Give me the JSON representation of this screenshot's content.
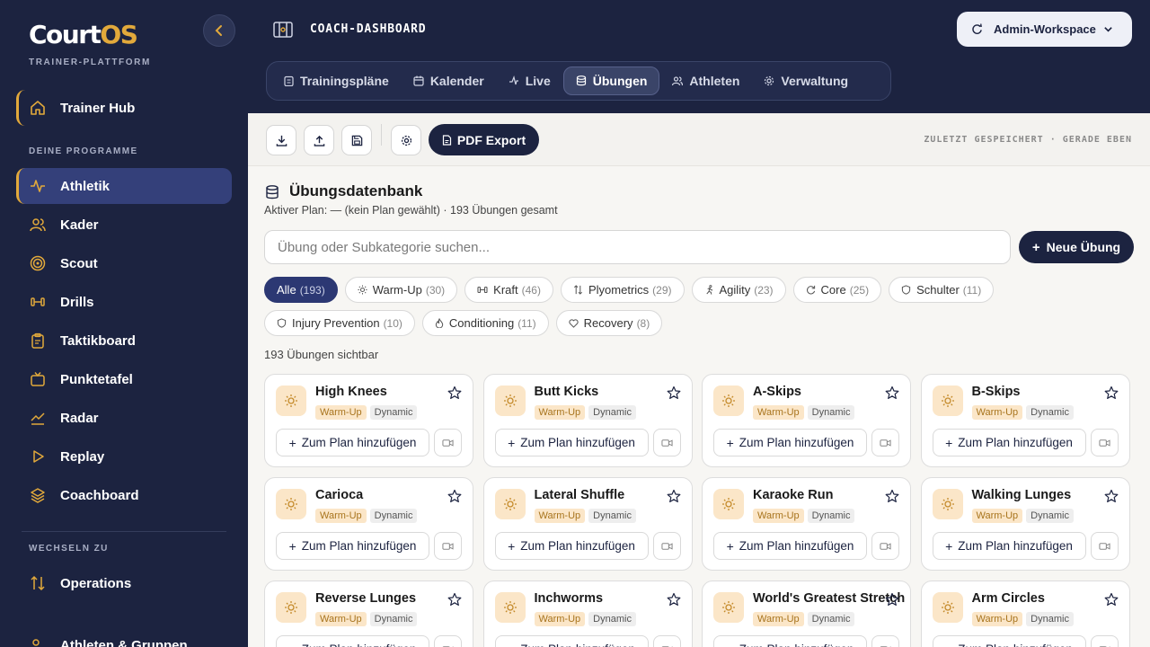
{
  "brand": {
    "name_part1": "Court",
    "name_part2": "OS",
    "subtitle": "TRAINER-PLATTFORM",
    "accent_color": "#e2a93b",
    "navy_color": "#1c2340"
  },
  "sidebar": {
    "hub_label": "Trainer Hub",
    "programs_heading": "DEINE PROGRAMME",
    "items": [
      {
        "label": "Athletik",
        "icon": "activity-icon",
        "active": true
      },
      {
        "label": "Kader",
        "icon": "users-icon"
      },
      {
        "label": "Scout",
        "icon": "target-icon"
      },
      {
        "label": "Drills",
        "icon": "dumbbell-icon"
      },
      {
        "label": "Taktikboard",
        "icon": "clipboard-icon"
      },
      {
        "label": "Punktetafel",
        "icon": "tv-icon"
      },
      {
        "label": "Radar",
        "icon": "chart-line-icon"
      },
      {
        "label": "Replay",
        "icon": "play-icon"
      },
      {
        "label": "Coachboard",
        "icon": "layers-icon"
      }
    ],
    "switch_heading": "WECHSELN ZU",
    "switch_item": "Operations",
    "bottom_item": "Athleten & Gruppen"
  },
  "header": {
    "title": "COACH-DASHBOARD",
    "workspace": "Admin-Workspace",
    "tabs": [
      {
        "label": "Trainingspläne",
        "icon": "clipboard-icon"
      },
      {
        "label": "Kalender",
        "icon": "calendar-icon"
      },
      {
        "label": "Live",
        "icon": "pulse-icon"
      },
      {
        "label": "Übungen",
        "icon": "database-icon",
        "active": true
      },
      {
        "label": "Athleten",
        "icon": "users-icon"
      },
      {
        "label": "Verwaltung",
        "icon": "gear-icon"
      }
    ]
  },
  "toolbar": {
    "pdf_label": "PDF Export",
    "saved_status": "ZULETZT GESPEICHERT · GERADE EBEN"
  },
  "database": {
    "title": "Übungsdatenbank",
    "subtitle": "Aktiver Plan: — (kein Plan gewählt) · 193 Übungen gesamt",
    "search_placeholder": "Übung oder Subkategorie suchen...",
    "new_button": "Neue Übung",
    "visible_count": "193 Übungen sichtbar"
  },
  "filters": [
    {
      "label": "Alle",
      "count": "(193)",
      "active": true
    },
    {
      "label": "Warm-Up",
      "count": "(30)",
      "icon": "sun-icon"
    },
    {
      "label": "Kraft",
      "count": "(46)",
      "icon": "dumbbell-icon"
    },
    {
      "label": "Plyometrics",
      "count": "(29)",
      "icon": "arrows-updown-icon"
    },
    {
      "label": "Agility",
      "count": "(23)",
      "icon": "runner-icon"
    },
    {
      "label": "Core",
      "count": "(25)",
      "icon": "refresh-icon"
    },
    {
      "label": "Schulter",
      "count": "(11)",
      "icon": "shield-icon"
    },
    {
      "label": "Injury Prevention",
      "count": "(10)",
      "icon": "shield-icon"
    },
    {
      "label": "Conditioning",
      "count": "(11)",
      "icon": "flame-icon"
    },
    {
      "label": "Recovery",
      "count": "(8)",
      "icon": "heart-icon"
    }
  ],
  "card_actions": {
    "add_label": "Zum Plan hinzufügen"
  },
  "exercises": [
    {
      "name": "High Knees",
      "category": "Warm-Up",
      "type": "Dynamic"
    },
    {
      "name": "Butt Kicks",
      "category": "Warm-Up",
      "type": "Dynamic"
    },
    {
      "name": "A-Skips",
      "category": "Warm-Up",
      "type": "Dynamic"
    },
    {
      "name": "B-Skips",
      "category": "Warm-Up",
      "type": "Dynamic"
    },
    {
      "name": "Carioca",
      "category": "Warm-Up",
      "type": "Dynamic"
    },
    {
      "name": "Lateral Shuffle",
      "category": "Warm-Up",
      "type": "Dynamic"
    },
    {
      "name": "Karaoke Run",
      "category": "Warm-Up",
      "type": "Dynamic"
    },
    {
      "name": "Walking Lunges",
      "category": "Warm-Up",
      "type": "Dynamic"
    },
    {
      "name": "Reverse Lunges",
      "category": "Warm-Up",
      "type": "Dynamic"
    },
    {
      "name": "Inchworms",
      "category": "Warm-Up",
      "type": "Dynamic"
    },
    {
      "name": "World's Greatest Stretch",
      "category": "Warm-Up",
      "type": "Dynamic"
    },
    {
      "name": "Arm Circles",
      "category": "Warm-Up",
      "type": "Dynamic"
    }
  ]
}
